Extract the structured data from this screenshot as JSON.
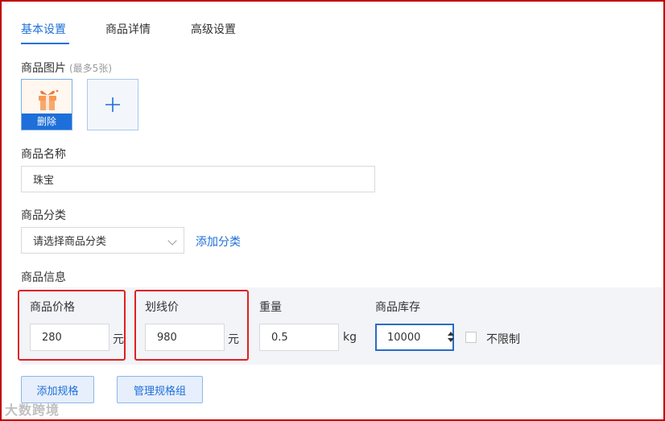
{
  "tabs": [
    {
      "label": "基本设置",
      "active": true
    },
    {
      "label": "商品详情",
      "active": false
    },
    {
      "label": "高级设置",
      "active": false
    }
  ],
  "images": {
    "label": "商品图片",
    "hint": "(最多5张)",
    "delete_label": "删除",
    "add_icon": "plus-icon"
  },
  "name": {
    "label": "商品名称",
    "value": "珠宝"
  },
  "category": {
    "label": "商品分类",
    "select_value": "请选择商品分类",
    "add_link": "添加分类"
  },
  "info": {
    "label": "商品信息",
    "price": {
      "label": "商品价格",
      "value": "280",
      "unit": "元"
    },
    "strike_price": {
      "label": "划线价",
      "value": "980",
      "unit": "元"
    },
    "weight": {
      "label": "重量",
      "value": "0.5",
      "unit": "kg"
    },
    "stock": {
      "label": "商品库存",
      "value": "10000",
      "unlimited_label": "不限制",
      "unlimited_checked": false
    }
  },
  "buttons": {
    "add_spec": "添加规格",
    "manage_spec_group": "管理规格组"
  },
  "watermark": "大数跨境",
  "colors": {
    "accent": "#1e6fd9",
    "highlight_border": "#e02020",
    "frame_border": "#c00000"
  }
}
